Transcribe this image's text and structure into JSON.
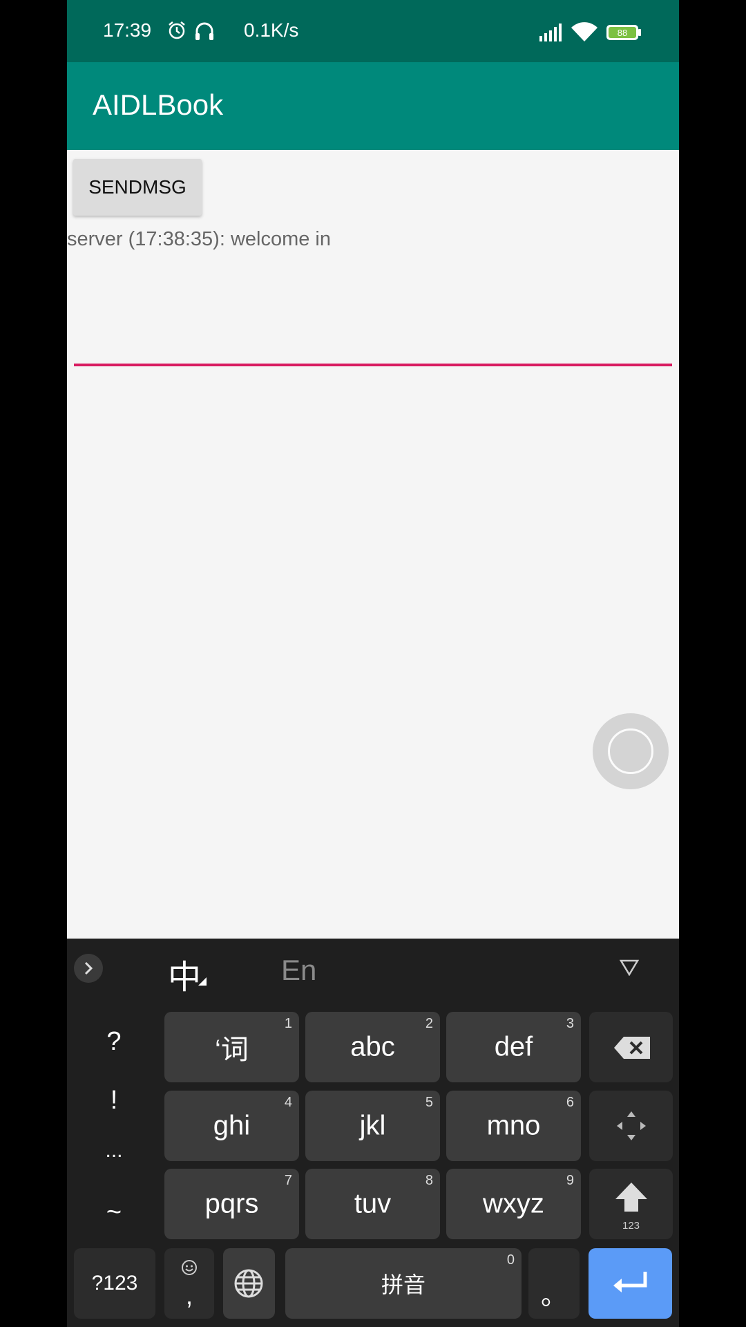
{
  "status_bar": {
    "time": "17:39",
    "net_speed": "0.1K/s",
    "battery": "88"
  },
  "app": {
    "title": "AIDLBook"
  },
  "content": {
    "send_button": "SENDMSG",
    "message": "server (17:38:35): welcome in",
    "edit_value": "",
    "accent_color": "#d81b60"
  },
  "keyboard": {
    "mode_zh": "中",
    "mode_en": "En",
    "symbols": [
      "?",
      "!",
      "...",
      "~"
    ],
    "keys": [
      {
        "label": "‘词",
        "num": "1"
      },
      {
        "label": "abc",
        "num": "2"
      },
      {
        "label": "def",
        "num": "3"
      },
      {
        "label": "ghi",
        "num": "4"
      },
      {
        "label": "jkl",
        "num": "5"
      },
      {
        "label": "mno",
        "num": "6"
      },
      {
        "label": "pqrs",
        "num": "7"
      },
      {
        "label": "tuv",
        "num": "8"
      },
      {
        "label": "wxyz",
        "num": "9"
      }
    ],
    "shift_sub": "123",
    "sym_key": "?123",
    "comma": ",",
    "space_label": "拼音",
    "space_num": "0",
    "period": "。",
    "enter_color": "#5b9bf7"
  }
}
